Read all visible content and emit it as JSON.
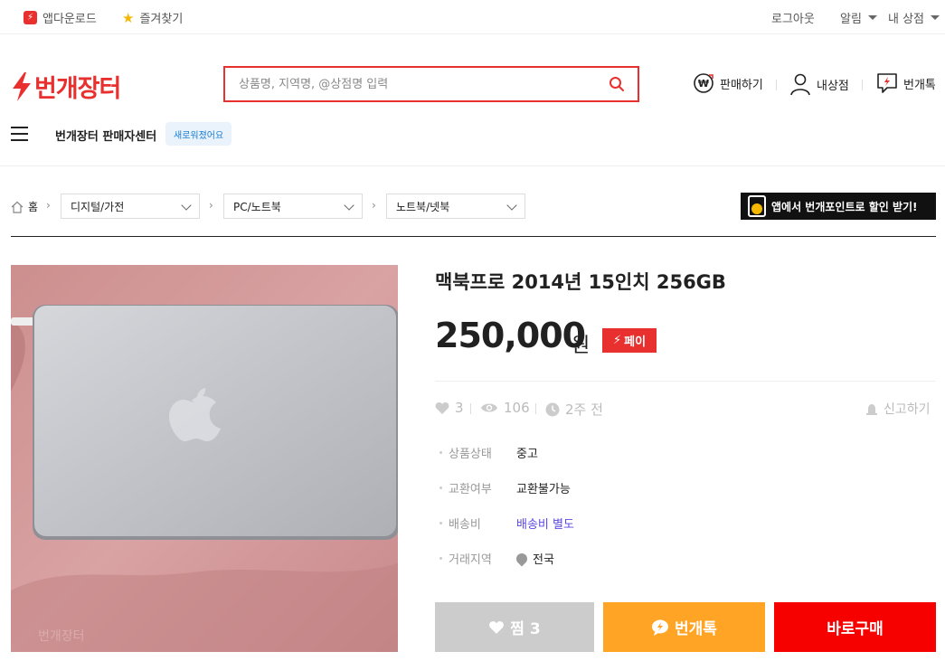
{
  "topbar": {
    "app_download": "앱다운로드",
    "favorites": "즐겨찾기",
    "logout": "로그아웃",
    "alarm": "알림",
    "my_store": "내 상점"
  },
  "header": {
    "logo_text": "번개장터",
    "search": {
      "placeholder": "상품명, 지역명, @상점명 입력"
    },
    "actions": {
      "sell": "판매하기",
      "my_store": "내상점",
      "talk": "번개톡"
    },
    "seller_center": "번개장터 판매자센터",
    "new_badge": "새로워졌어요"
  },
  "breadcrumb": {
    "home": "홈",
    "levels": [
      "디지털/가전",
      "PC/노트북",
      "노트북/넷북"
    ],
    "promo": "앱에서 번개포인트로 할인 받기!"
  },
  "product": {
    "title": "맥북프로 2014년 15인치 256GB",
    "price": "250,000",
    "currency": "원",
    "pay_badge": "페이",
    "stats": {
      "likes": "3",
      "views": "106",
      "time": "2주 전"
    },
    "report": "신고하기",
    "details": [
      {
        "label": "상품상태",
        "value": "중고"
      },
      {
        "label": "교환여부",
        "value": "교환불가능"
      },
      {
        "label": "배송비",
        "value": "배송비 별도"
      },
      {
        "label": "거래지역",
        "value": "전국"
      }
    ],
    "watermark": "번개장터"
  },
  "buttons": {
    "wish": "찜 3",
    "talk": "번개톡",
    "buy": "바로구매"
  },
  "colors": {
    "brand": "#e8312f",
    "talk": "#ffa425",
    "buy": "#f70000",
    "wish": "#cccccc",
    "shipping": "#5a48e0"
  }
}
